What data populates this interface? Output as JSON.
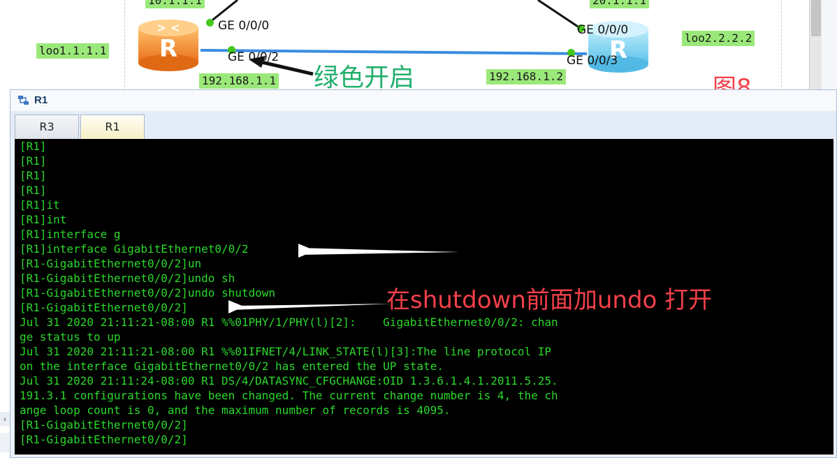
{
  "topology": {
    "top_left_label": "10.1.1.1",
    "top_right_label": "20.1.1.1",
    "loopback_left": "loo1.1.1.1",
    "loopback_right": "loo2.2.2.2",
    "left_ip": "192.168.1.1",
    "right_ip": "192.168.1.2",
    "r1_port_top": "GE 0/0/0",
    "r1_port_link": "GE 0/0/2",
    "r2_port_top": "GE 0/0/0",
    "r2_port_link": "GE 0/0/3",
    "router_letter": "R",
    "colors": {
      "label_bg": "#9be87a",
      "link": "#3a8de0",
      "port_up": "#45c81b",
      "router_left": "#f08a2a",
      "router_right": "#7fd3ef"
    }
  },
  "annotations": {
    "green_on": "绿色开启",
    "figure": "图8",
    "undo_note": "在shutdown前面加undo 打开"
  },
  "window": {
    "title": "R1",
    "icon": "network-device-icon",
    "tabs": [
      {
        "label": "R3",
        "active": false
      },
      {
        "label": "R1",
        "active": true
      }
    ]
  },
  "terminal": {
    "lines": [
      "[R1]",
      "[R1]",
      "[R1]",
      "[R1]",
      "[R1]it",
      "[R1]int",
      "[R1]interface g",
      "[R1]interface GigabitEthernet0/0/2",
      "[R1-GigabitEthernet0/0/2]un",
      "[R1-GigabitEthernet0/0/2]undo sh",
      "[R1-GigabitEthernet0/0/2]undo shutdown",
      "[R1-GigabitEthernet0/0/2]",
      "Jul 31 2020 21:11:21-08:00 R1 %%01PHY/1/PHY(l)[2]:    GigabitEthernet0/0/2: chan",
      "ge status to up",
      "Jul 31 2020 21:11:21-08:00 R1 %%01IFNET/4/LINK_STATE(l)[3]:The line protocol IP",
      "on the interface GigabitEthernet0/0/2 has entered the UP state.",
      "Jul 31 2020 21:11:24-08:00 R1 DS/4/DATASYNC_CFGCHANGE:OID 1.3.6.1.4.1.2011.5.25.",
      "191.3.1 configurations have been changed. The current change number is 4, the ch",
      "ange loop count is 0, and the maximum number of records is 4095.",
      "[R1-GigabitEthernet0/0/2]",
      "[R1-GigabitEthernet0/0/2]"
    ],
    "text_color": "#2bd82b",
    "background": "#000000"
  }
}
